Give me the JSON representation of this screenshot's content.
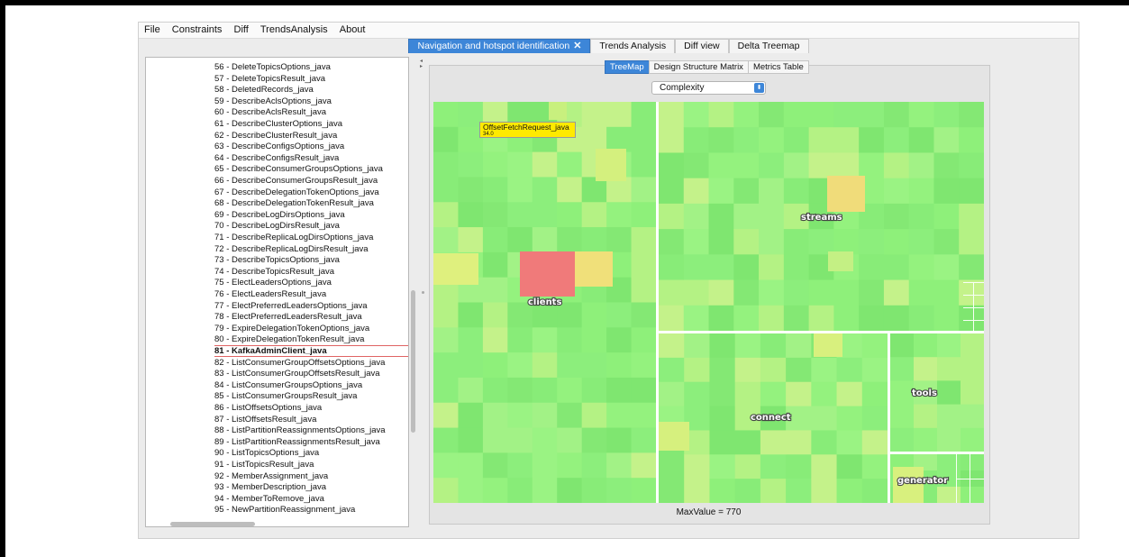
{
  "menu": [
    "File",
    "Constraints",
    "Diff",
    "TrendsAnalysis",
    "About"
  ],
  "main_tabs": [
    {
      "label": "Navigation and hotspot identification",
      "active": true,
      "closable": true
    },
    {
      "label": "Trends Analysis",
      "active": false
    },
    {
      "label": "Diff view",
      "active": false
    },
    {
      "label": "Delta Treemap",
      "active": false
    }
  ],
  "close_icon": "close-icon",
  "class_list": [
    "56 - DeleteTopicsOptions_java",
    "57 - DeleteTopicsResult_java",
    "58 - DeletedRecords_java",
    "59 - DescribeAclsOptions_java",
    "60 - DescribeAclsResult_java",
    "61 - DescribeClusterOptions_java",
    "62 - DescribeClusterResult_java",
    "63 - DescribeConfigsOptions_java",
    "64 - DescribeConfigsResult_java",
    "65 - DescribeConsumerGroupsOptions_java",
    "66 - DescribeConsumerGroupsResult_java",
    "67 - DescribeDelegationTokenOptions_java",
    "68 - DescribeDelegationTokenResult_java",
    "69 - DescribeLogDirsOptions_java",
    "70 - DescribeLogDirsResult_java",
    "71 - DescribeReplicaLogDirsOptions_java",
    "72 - DescribeReplicaLogDirsResult_java",
    "73 - DescribeTopicsOptions_java",
    "74 - DescribeTopicsResult_java",
    "75 - ElectLeadersOptions_java",
    "76 - ElectLeadersResult_java",
    "77 - ElectPreferredLeadersOptions_java",
    "78 - ElectPreferredLeadersResult_java",
    "79 - ExpireDelegationTokenOptions_java",
    "80 - ExpireDelegationTokenResult_java",
    "81 - KafkaAdminClient_java",
    "82 - ListConsumerGroupOffsetsOptions_java",
    "83 - ListConsumerGroupOffsetsResult_java",
    "84 - ListConsumerGroupsOptions_java",
    "85 - ListConsumerGroupsResult_java",
    "86 - ListOffsetsOptions_java",
    "87 - ListOffsetsResult_java",
    "88 - ListPartitionReassignmentsOptions_java",
    "89 - ListPartitionReassignmentsResult_java",
    "90 - ListTopicsOptions_java",
    "91 - ListTopicsResult_java",
    "92 - MemberAssignment_java",
    "93 - MemberDescription_java",
    "94 - MemberToRemove_java",
    "95 - NewPartitionReassignment_java"
  ],
  "selected_class": "81 - KafkaAdminClient_java",
  "view_tabs": [
    {
      "label": "TreeMap",
      "active": true
    },
    {
      "label": "Design Structure Matrix",
      "active": false
    },
    {
      "label": "Metrics Table",
      "active": false
    }
  ],
  "metric_select": {
    "value": "Complexity",
    "icon": "chevron-up-down-icon"
  },
  "treemap": {
    "regions": [
      "clients",
      "streams",
      "connect",
      "tools",
      "generator"
    ],
    "base_color": "#8ef07a",
    "hot_color": "#f07a7a",
    "warm_color": "#f0e07a",
    "tooltip": {
      "name": "OffsetFetchRequest_java",
      "value": "34.0"
    }
  },
  "status": {
    "max_value": "MaxValue = 770"
  },
  "colors": {
    "accent": "#3d86d8",
    "selection": "#e06464"
  }
}
